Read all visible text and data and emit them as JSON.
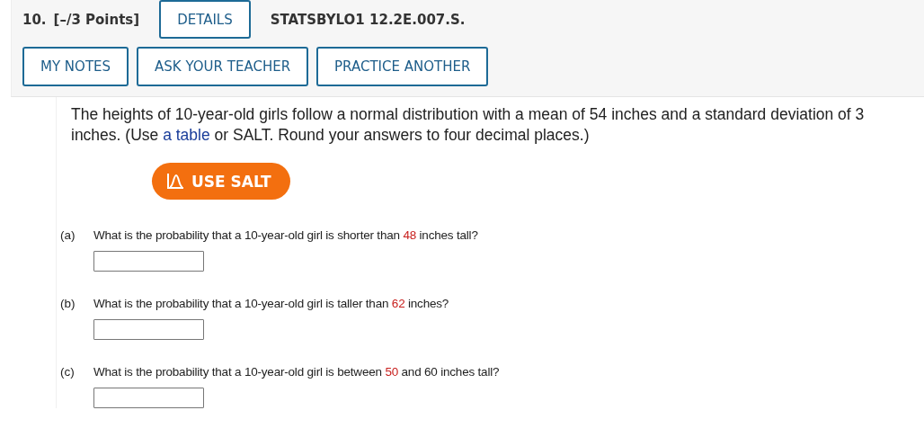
{
  "header": {
    "number": "10.",
    "points": "[–/3 Points]",
    "details_button": "DETAILS",
    "code": "STATSBYLO1 12.2E.007.S.",
    "buttons": [
      "MY NOTES",
      "ASK YOUR TEACHER",
      "PRACTICE ANOTHER"
    ]
  },
  "intro": {
    "before": "The heights of 10-year-old girls follow a normal distribution with a mean of 54 inches and a standard deviation of 3 inches. (Use ",
    "link": "a table",
    "after": " or SALT. Round your answers to four decimal places.)"
  },
  "salt_button": "USE SALT",
  "questions": [
    {
      "label": "(a)",
      "parts": [
        {
          "text": "What is the probability that a 10-year-old girl is shorter than ",
          "highlight": false
        },
        {
          "text": "48",
          "highlight": true
        },
        {
          "text": " inches tall?",
          "highlight": false
        }
      ]
    },
    {
      "label": "(b)",
      "parts": [
        {
          "text": "What is the probability that a 10-year-old girl is taller than ",
          "highlight": false
        },
        {
          "text": "62",
          "highlight": true
        },
        {
          "text": " inches?",
          "highlight": false
        }
      ]
    },
    {
      "label": "(c)",
      "parts": [
        {
          "text": "What is the probability that a 10-year-old girl is between ",
          "highlight": false
        },
        {
          "text": "50",
          "highlight": true
        },
        {
          "text": " and 60 inches tall?",
          "highlight": false
        }
      ]
    }
  ]
}
